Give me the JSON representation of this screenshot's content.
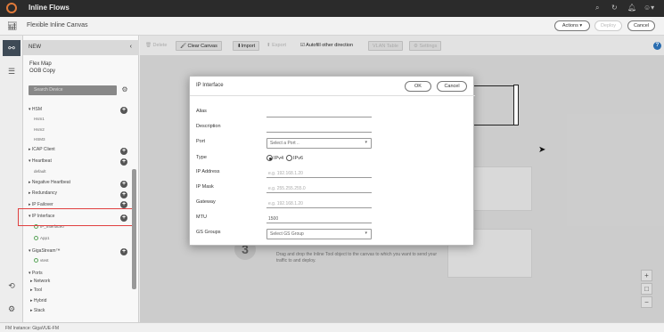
{
  "topbar": {
    "title": "Inline Flows",
    "icons": [
      "search-icon",
      "refresh-icon",
      "bell-icon",
      "user-icon"
    ]
  },
  "subbar": {
    "title": "Flexible Inline Canvas",
    "actions_label": "Actions ▾",
    "deploy_label": "Deploy",
    "cancel_label": "Cancel"
  },
  "sidebar": {
    "new_label": "NEW",
    "info_lines": [
      "Flex Map",
      "OOB Copy"
    ],
    "search_placeholder": "Search Device",
    "tree": {
      "hsm": "▾ HSM",
      "hsm1": "Hsm1",
      "hsm2": "Hsm2",
      "hsm3": "HSM3",
      "icap": "▸ ICAP Client",
      "heartbeat": "▾ Heartbeat",
      "default": "default",
      "neg_heartbeat": "▸ Negative Heartbeat",
      "redundancy": "▸ Redundancy",
      "ip_failover": "▸ IP Failover",
      "ip_interface": "▾ IP Interface",
      "ip_interface0": "IP_Interface0",
      "app1": "App1",
      "gigastream": "▾ GigaStream™",
      "vtest": "vtest",
      "ports": "▾ Ports",
      "network": "▸ Network",
      "tool": "▸ Tool",
      "hybrid": "▸ Hybrid",
      "stack": "▸ Stack"
    }
  },
  "toolbar": {
    "delete": "🗑 Delete",
    "clear_canvas": "🖌 Clear Canvas",
    "import": "⬇Import",
    "export": "⬆ Export",
    "autofill": "☑ Autofill other direction",
    "vlan_table": "VLAN Table",
    "settings": "⚙ Settings"
  },
  "modal": {
    "title": "IP Interface",
    "ok_label": "OK",
    "cancel_label": "Cancel",
    "fields": {
      "alias_label": "Alias",
      "description_label": "Description",
      "port_label": "Port",
      "port_placeholder": "Select a Port ..",
      "type_label": "Type",
      "ipv4_label": "IPv4",
      "ipv6_label": "IPv6",
      "ip_address_label": "IP Address",
      "ip_address_placeholder": "e.g. 192.168.1.20",
      "ip_mask_label": "IP Mask",
      "ip_mask_placeholder": "e.g. 255.255.255.0",
      "gateway_label": "Gateway",
      "gateway_placeholder": "e.g. 192.168.1.20",
      "mtu_label": "MTU",
      "mtu_value": "1500",
      "gs_groups_label": "GS Groups",
      "gs_groups_placeholder": "Select GS Group"
    }
  },
  "canvas": {
    "step_number": "3",
    "step_text": "Drag and drop the Inline Tool object to the canvas to which you want to send your traffic to and deploy."
  },
  "footer": {
    "instance": "FM Instance: GigaVUE-FM"
  }
}
